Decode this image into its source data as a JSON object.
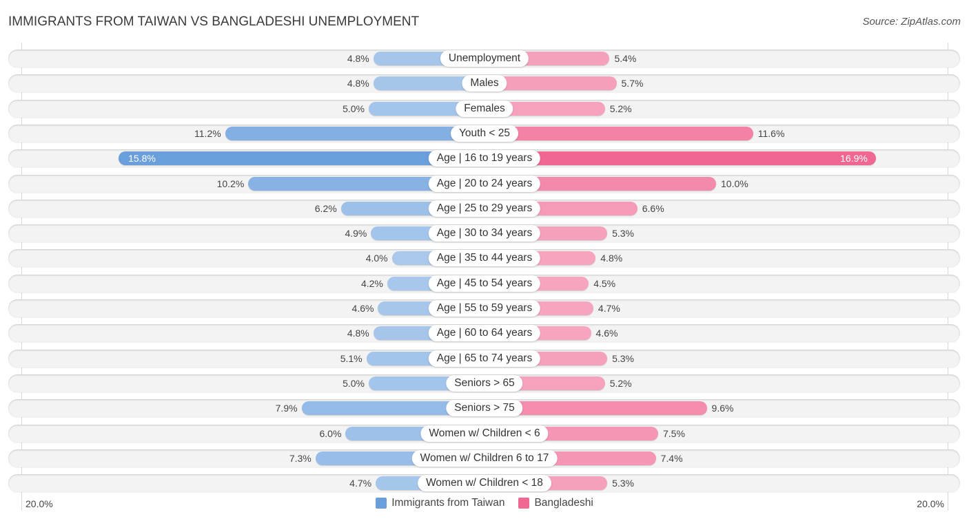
{
  "header": {
    "title": "IMMIGRANTS FROM TAIWAN VS BANGLADESHI UNEMPLOYMENT",
    "source": "Source: ZipAtlas.com"
  },
  "chart_data": {
    "type": "bar",
    "orientation": "horizontal-diverging",
    "title": "IMMIGRANTS FROM TAIWAN VS BANGLADESHI UNEMPLOYMENT",
    "categories": [
      "Unemployment",
      "Males",
      "Females",
      "Youth < 25",
      "Age | 16 to 19 years",
      "Age | 20 to 24 years",
      "Age | 25 to 29 years",
      "Age | 30 to 34 years",
      "Age | 35 to 44 years",
      "Age | 45 to 54 years",
      "Age | 55 to 59 years",
      "Age | 60 to 64 years",
      "Age | 65 to 74 years",
      "Seniors > 65",
      "Seniors > 75",
      "Women w/ Children < 6",
      "Women w/ Children 6 to 17",
      "Women w/ Children < 18"
    ],
    "series": [
      {
        "name": "Immigrants from Taiwan",
        "side": "left",
        "color": "#6a9fdc",
        "color_light": "#a9c8ec",
        "values": [
          4.8,
          4.8,
          5.0,
          11.2,
          15.8,
          10.2,
          6.2,
          4.9,
          4.0,
          4.2,
          4.6,
          4.8,
          5.1,
          5.0,
          7.9,
          6.0,
          7.3,
          4.7
        ],
        "labels": [
          "4.8%",
          "4.8%",
          "5.0%",
          "11.2%",
          "15.8%",
          "10.2%",
          "6.2%",
          "4.9%",
          "4.0%",
          "4.2%",
          "4.6%",
          "4.8%",
          "5.1%",
          "5.0%",
          "7.9%",
          "6.0%",
          "7.3%",
          "4.7%"
        ]
      },
      {
        "name": "Bangladeshi",
        "side": "right",
        "color": "#f06792",
        "color_light": "#f7a8c0",
        "values": [
          5.4,
          5.7,
          5.2,
          11.6,
          16.9,
          10.0,
          6.6,
          5.3,
          4.8,
          4.5,
          4.7,
          4.6,
          5.3,
          5.2,
          9.6,
          7.5,
          7.4,
          5.3
        ],
        "labels": [
          "5.4%",
          "5.7%",
          "5.2%",
          "11.6%",
          "16.9%",
          "10.0%",
          "6.6%",
          "5.3%",
          "4.8%",
          "4.5%",
          "4.7%",
          "4.6%",
          "5.3%",
          "5.2%",
          "9.6%",
          "7.5%",
          "7.4%",
          "5.3%"
        ]
      }
    ],
    "xlim": [
      -20,
      20
    ],
    "axis_labels": {
      "left": "20.0%",
      "right": "20.0%"
    },
    "xlabel": "",
    "ylabel": "",
    "grid": false,
    "legend_position": "bottom-center"
  }
}
